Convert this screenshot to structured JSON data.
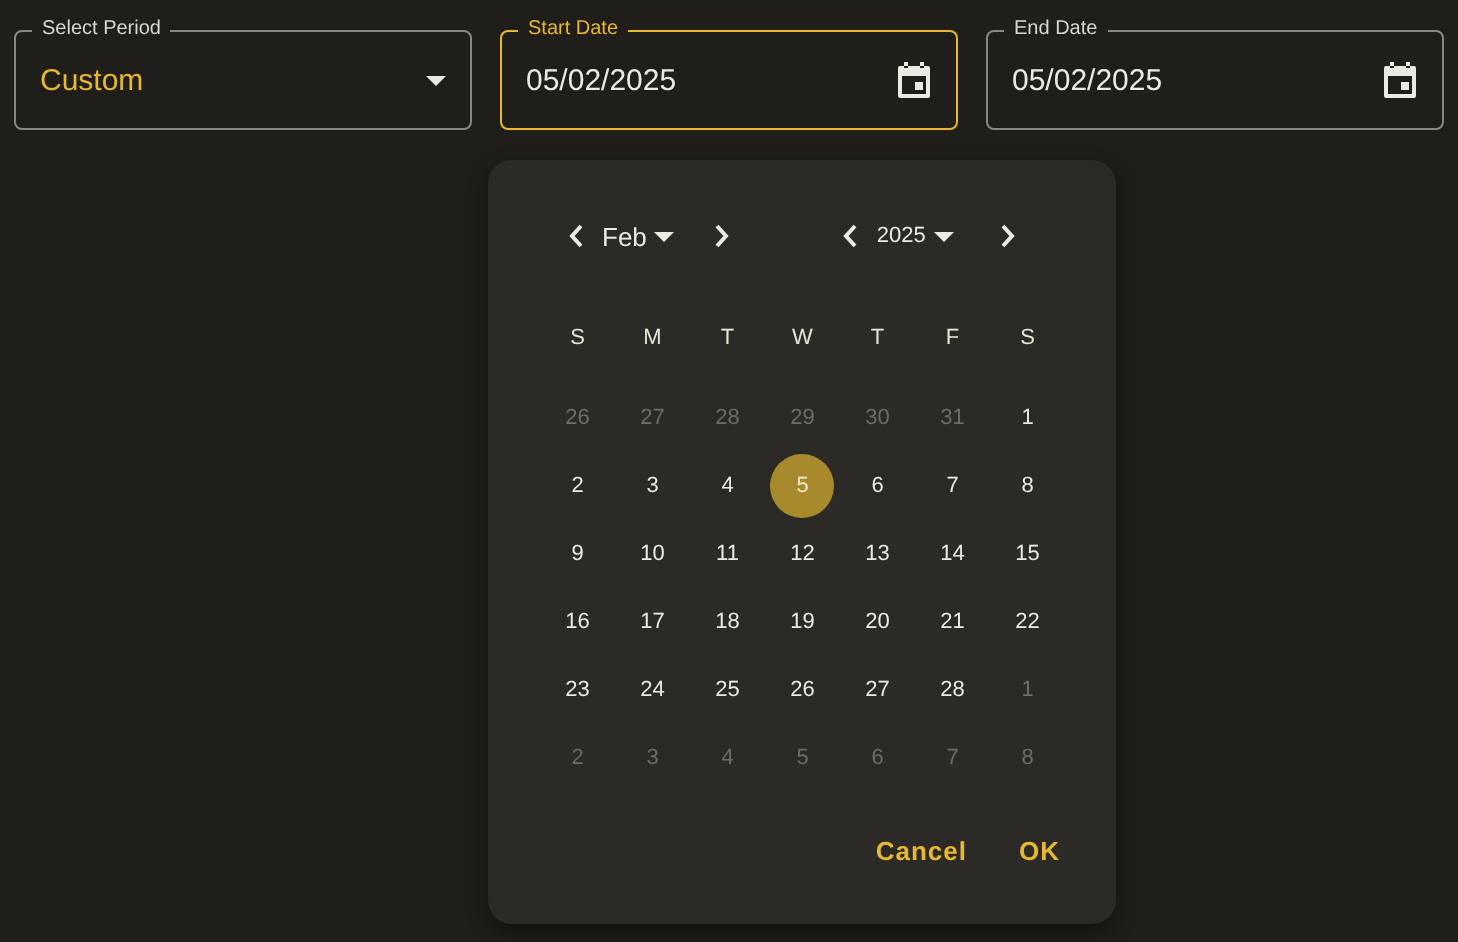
{
  "fields": [
    {
      "kind": "select",
      "label": "Select Period",
      "value": "Custom",
      "focused": false
    },
    {
      "kind": "date",
      "label": "Start Date",
      "value": "05/02/2025",
      "focused": true
    },
    {
      "kind": "date",
      "label": "End Date",
      "value": "05/02/2025",
      "focused": false
    }
  ],
  "calendar": {
    "month": "Feb",
    "year": "2025",
    "weekdays": [
      "S",
      "M",
      "T",
      "W",
      "T",
      "F",
      "S"
    ],
    "weeks": [
      [
        {
          "day": "26",
          "outside": true,
          "selected": false
        },
        {
          "day": "27",
          "outside": true,
          "selected": false
        },
        {
          "day": "28",
          "outside": true,
          "selected": false
        },
        {
          "day": "29",
          "outside": true,
          "selected": false
        },
        {
          "day": "30",
          "outside": true,
          "selected": false
        },
        {
          "day": "31",
          "outside": true,
          "selected": false
        },
        {
          "day": "1",
          "outside": false,
          "selected": false
        }
      ],
      [
        {
          "day": "2",
          "outside": false,
          "selected": false
        },
        {
          "day": "3",
          "outside": false,
          "selected": false
        },
        {
          "day": "4",
          "outside": false,
          "selected": false
        },
        {
          "day": "5",
          "outside": false,
          "selected": true
        },
        {
          "day": "6",
          "outside": false,
          "selected": false
        },
        {
          "day": "7",
          "outside": false,
          "selected": false
        },
        {
          "day": "8",
          "outside": false,
          "selected": false
        }
      ],
      [
        {
          "day": "9",
          "outside": false,
          "selected": false
        },
        {
          "day": "10",
          "outside": false,
          "selected": false
        },
        {
          "day": "11",
          "outside": false,
          "selected": false
        },
        {
          "day": "12",
          "outside": false,
          "selected": false
        },
        {
          "day": "13",
          "outside": false,
          "selected": false
        },
        {
          "day": "14",
          "outside": false,
          "selected": false
        },
        {
          "day": "15",
          "outside": false,
          "selected": false
        }
      ],
      [
        {
          "day": "16",
          "outside": false,
          "selected": false
        },
        {
          "day": "17",
          "outside": false,
          "selected": false
        },
        {
          "day": "18",
          "outside": false,
          "selected": false
        },
        {
          "day": "19",
          "outside": false,
          "selected": false
        },
        {
          "day": "20",
          "outside": false,
          "selected": false
        },
        {
          "day": "21",
          "outside": false,
          "selected": false
        },
        {
          "day": "22",
          "outside": false,
          "selected": false
        }
      ],
      [
        {
          "day": "23",
          "outside": false,
          "selected": false
        },
        {
          "day": "24",
          "outside": false,
          "selected": false
        },
        {
          "day": "25",
          "outside": false,
          "selected": false
        },
        {
          "day": "26",
          "outside": false,
          "selected": false
        },
        {
          "day": "27",
          "outside": false,
          "selected": false
        },
        {
          "day": "28",
          "outside": false,
          "selected": false
        },
        {
          "day": "1",
          "outside": true,
          "selected": false
        }
      ],
      [
        {
          "day": "2",
          "outside": true,
          "selected": false
        },
        {
          "day": "3",
          "outside": true,
          "selected": false
        },
        {
          "day": "4",
          "outside": true,
          "selected": false
        },
        {
          "day": "5",
          "outside": true,
          "selected": false
        },
        {
          "day": "6",
          "outside": true,
          "selected": false
        },
        {
          "day": "7",
          "outside": true,
          "selected": false
        },
        {
          "day": "8",
          "outside": true,
          "selected": false
        }
      ]
    ],
    "actions": [
      "Cancel",
      "OK"
    ]
  }
}
